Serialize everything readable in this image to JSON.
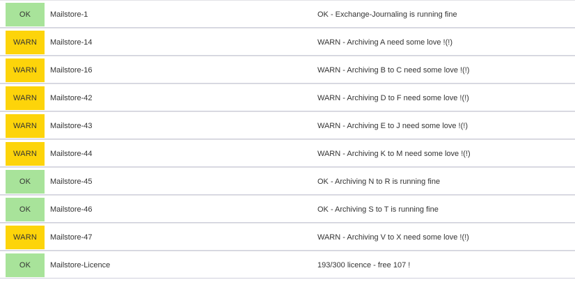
{
  "colors": {
    "ok": "#a8e39a",
    "warn": "#fdd40a",
    "text": "#333333",
    "separator": "#cfd0dc"
  },
  "rows": [
    {
      "state": "OK",
      "service": "Mailstore-1",
      "output": "OK - Exchange-Journaling is running fine"
    },
    {
      "state": "WARN",
      "service": "Mailstore-14",
      "output": "WARN - Archiving A need some love !(!)"
    },
    {
      "state": "WARN",
      "service": "Mailstore-16",
      "output": "WARN - Archiving B to C need some love !(!)"
    },
    {
      "state": "WARN",
      "service": "Mailstore-42",
      "output": "WARN - Archiving D to F need some love !(!)"
    },
    {
      "state": "WARN",
      "service": "Mailstore-43",
      "output": "WARN - Archiving E to J need some love !(!)"
    },
    {
      "state": "WARN",
      "service": "Mailstore-44",
      "output": "WARN - Archiving K to M need some love !(!)"
    },
    {
      "state": "OK",
      "service": "Mailstore-45",
      "output": "OK - Archiving N to R is running fine"
    },
    {
      "state": "OK",
      "service": "Mailstore-46",
      "output": "OK - Archiving S to T is running fine"
    },
    {
      "state": "WARN",
      "service": "Mailstore-47",
      "output": "WARN - Archiving V to X need some love !(!)"
    },
    {
      "state": "OK",
      "service": "Mailstore-Licence",
      "output": "193/300 licence - free 107 !"
    }
  ]
}
